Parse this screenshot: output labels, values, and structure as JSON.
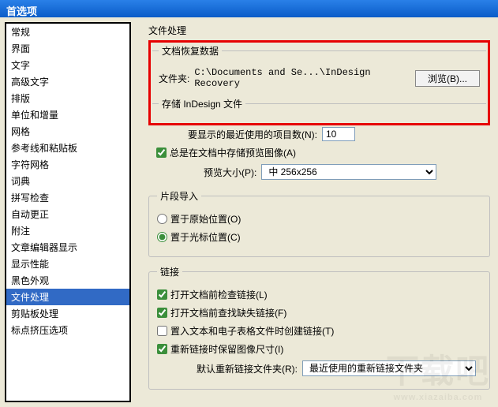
{
  "window": {
    "title": "首选项"
  },
  "sidebar": {
    "items": [
      "常规",
      "界面",
      "文字",
      "高级文字",
      "排版",
      "单位和增量",
      "网格",
      "参考线和粘贴板",
      "字符网格",
      "词典",
      "拼写检查",
      "自动更正",
      "附注",
      "文章编辑器显示",
      "显示性能",
      "黑色外观",
      "文件处理",
      "剪贴板处理",
      "标点挤压选项"
    ],
    "selectedIndex": 16
  },
  "main": {
    "title": "文件处理",
    "recovery": {
      "legend": "文档恢复数据",
      "folderLabel": "文件夹:",
      "folderPath": "C:\\Documents and Se...\\InDesign Recovery",
      "browse": "浏览(B)..."
    },
    "save": {
      "legend": "存储 InDesign 文件",
      "recentLabel": "要显示的最近使用的项目数(N):",
      "recentValue": "10",
      "alwaysPreview": "总是在文档中存储预览图像(A)",
      "previewSizeLabel": "预览大小(P):",
      "previewSizeValue": "中 256x256"
    },
    "fragment": {
      "legend": "片段导入",
      "originalPos": "置于原始位置(O)",
      "cursorPos": "置于光标位置(C)"
    },
    "links": {
      "legend": "链接",
      "checkBeforeOpen": "打开文档前检查链接(L)",
      "findMissing": "打开文档前查找缺失链接(F)",
      "createOnPlace": "置入文本和电子表格文件时创建链接(T)",
      "preserveDims": "重新链接时保留图像尺寸(I)",
      "defaultRelinkLabel": "默认重新链接文件夹(R):",
      "defaultRelinkValue": "最近使用的重新链接文件夹"
    }
  },
  "watermark": {
    "text": "下载吧",
    "url": "www.xiazaiba.com"
  }
}
